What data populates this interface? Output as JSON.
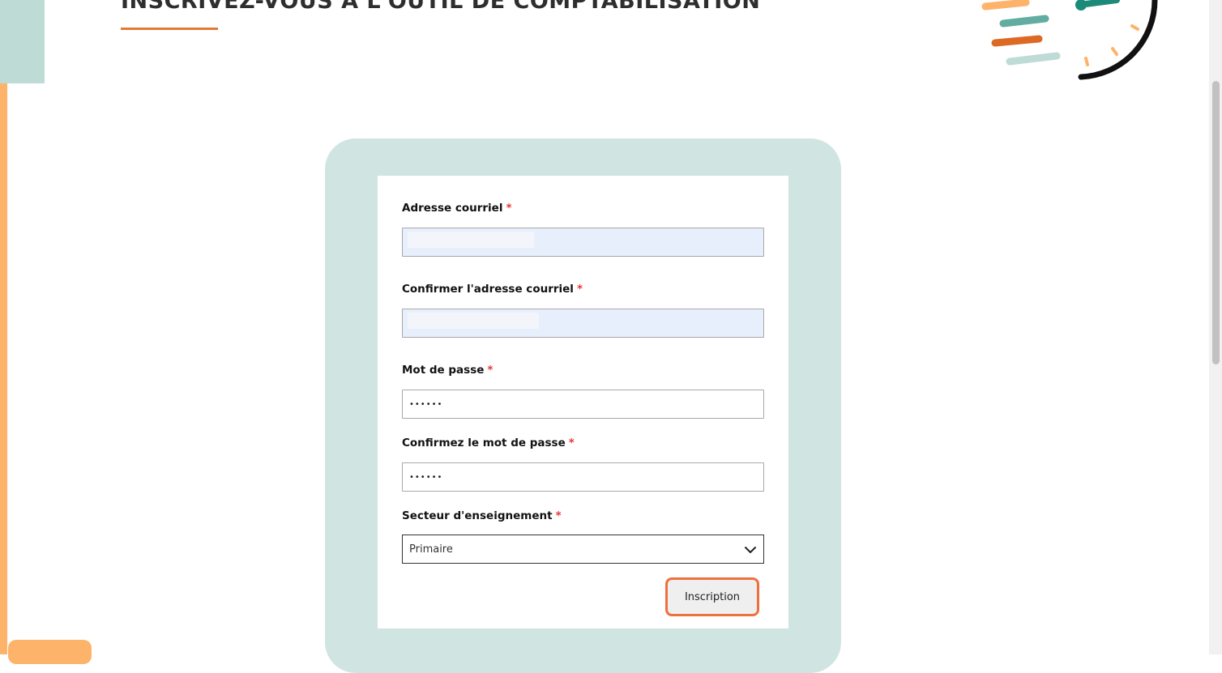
{
  "header": {
    "title": "INSCRIVEZ-VOUS À L'OUTIL DE COMPTABILISATION"
  },
  "form": {
    "fields": [
      {
        "label": "Adresse courriel",
        "required_mark": "*",
        "value": ""
      },
      {
        "label": "Confirmer l'adresse courriel",
        "required_mark": "*",
        "value": ""
      },
      {
        "label": "Mot de passe",
        "required_mark": "*",
        "value": "••••••"
      },
      {
        "label": "Confirmez le mot de passe",
        "required_mark": "*",
        "value": "••••••"
      }
    ],
    "sector": {
      "label": "Secteur d'enseignement",
      "required_mark": "*",
      "selected": "Primaire"
    },
    "submit_label": "Inscription"
  },
  "colors": {
    "accent_orange": "#f0703d",
    "panel_teal": "#d0e5e1",
    "deco_orange": "#fdb36a",
    "deco_teal": "#bedbd6",
    "title_underline": "#e07a35",
    "required_red": "#e53935",
    "autofill_blue": "#e8effc"
  },
  "icons": {
    "select_arrow": "chevron-down-icon",
    "illustration": "clock-illustration"
  }
}
